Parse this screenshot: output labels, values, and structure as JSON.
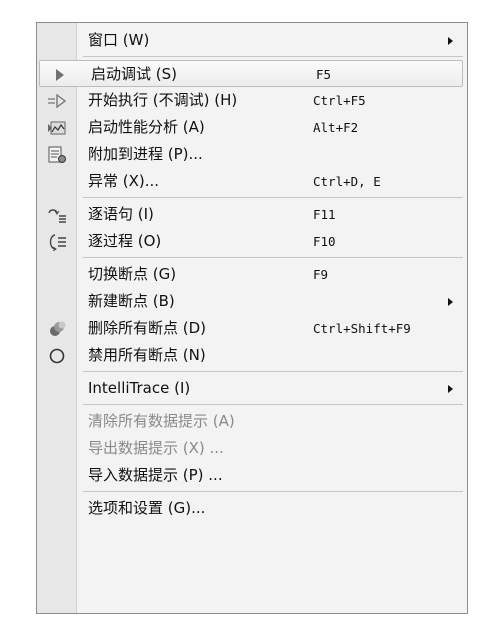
{
  "menu": {
    "items": [
      {
        "label": "窗口 (W)",
        "shortcut": "",
        "submenu": true,
        "icon": "",
        "disabled": false,
        "highlight": false
      },
      {
        "label": "启动调试 (S)",
        "shortcut": "F5",
        "submenu": false,
        "icon": "play-icon",
        "disabled": false,
        "highlight": true
      },
      {
        "label": "开始执行 (不调试) (H)",
        "shortcut": "Ctrl+F5",
        "submenu": false,
        "icon": "run-without-debug-icon",
        "disabled": false,
        "highlight": false
      },
      {
        "label": "启动性能分析 (A)",
        "shortcut": "Alt+F2",
        "submenu": false,
        "icon": "performance-icon",
        "disabled": false,
        "highlight": false
      },
      {
        "label": "附加到进程 (P)...",
        "shortcut": "",
        "submenu": false,
        "icon": "attach-process-icon",
        "disabled": false,
        "highlight": false
      },
      {
        "label": "异常 (X)...",
        "shortcut": "Ctrl+D, E",
        "submenu": false,
        "icon": "",
        "disabled": false,
        "highlight": false
      },
      {
        "label": "逐语句 (I)",
        "shortcut": "F11",
        "submenu": false,
        "icon": "step-into-icon",
        "disabled": false,
        "highlight": false
      },
      {
        "label": "逐过程 (O)",
        "shortcut": "F10",
        "submenu": false,
        "icon": "step-over-icon",
        "disabled": false,
        "highlight": false
      },
      {
        "label": "切换断点 (G)",
        "shortcut": "F9",
        "submenu": false,
        "icon": "",
        "disabled": false,
        "highlight": false
      },
      {
        "label": "新建断点 (B)",
        "shortcut": "",
        "submenu": true,
        "icon": "",
        "disabled": false,
        "highlight": false
      },
      {
        "label": "删除所有断点 (D)",
        "shortcut": "Ctrl+Shift+F9",
        "submenu": false,
        "icon": "delete-breakpoints-icon",
        "disabled": false,
        "highlight": false
      },
      {
        "label": "禁用所有断点 (N)",
        "shortcut": "",
        "submenu": false,
        "icon": "disable-breakpoints-icon",
        "disabled": false,
        "highlight": false
      },
      {
        "label": "IntelliTrace (I)",
        "shortcut": "",
        "submenu": true,
        "icon": "",
        "disabled": false,
        "highlight": false
      },
      {
        "label": "清除所有数据提示 (A)",
        "shortcut": "",
        "submenu": false,
        "icon": "",
        "disabled": true,
        "highlight": false
      },
      {
        "label": "导出数据提示 (X) ...",
        "shortcut": "",
        "submenu": false,
        "icon": "",
        "disabled": true,
        "highlight": false
      },
      {
        "label": "导入数据提示 (P) ...",
        "shortcut": "",
        "submenu": false,
        "icon": "",
        "disabled": false,
        "highlight": false
      },
      {
        "label": "选项和设置 (G)...",
        "shortcut": "",
        "submenu": false,
        "icon": "",
        "disabled": false,
        "highlight": false
      }
    ],
    "separators_after": [
      0,
      5,
      7,
      11,
      12,
      15
    ]
  }
}
